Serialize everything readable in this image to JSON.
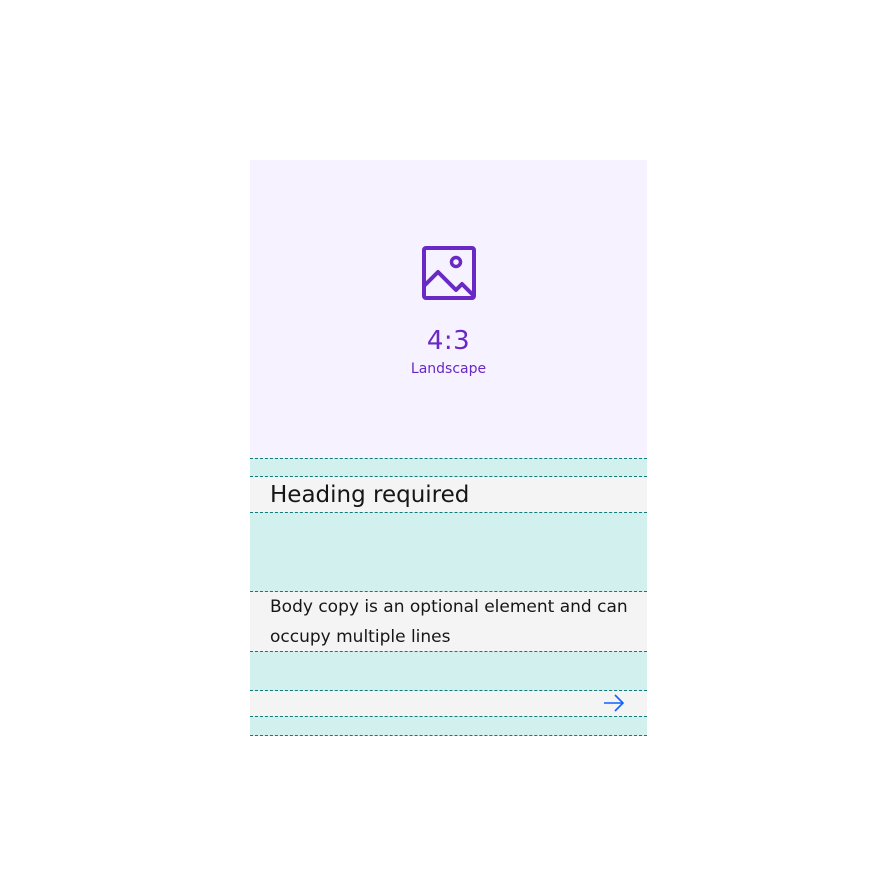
{
  "media": {
    "icon": "image-icon",
    "ratio": "4:3",
    "orientation": "Landscape"
  },
  "card": {
    "heading": "Heading required",
    "body": "Body copy is an optional element and can occupy multiple lines",
    "action_icon": "arrow-right-icon"
  },
  "colors": {
    "media_background": "#f6f2ff",
    "accent_purple": "#6929c4",
    "spacer_teal": "#d2f0ee",
    "card_background": "#f4f4f4",
    "link_blue": "#0f62fe"
  }
}
